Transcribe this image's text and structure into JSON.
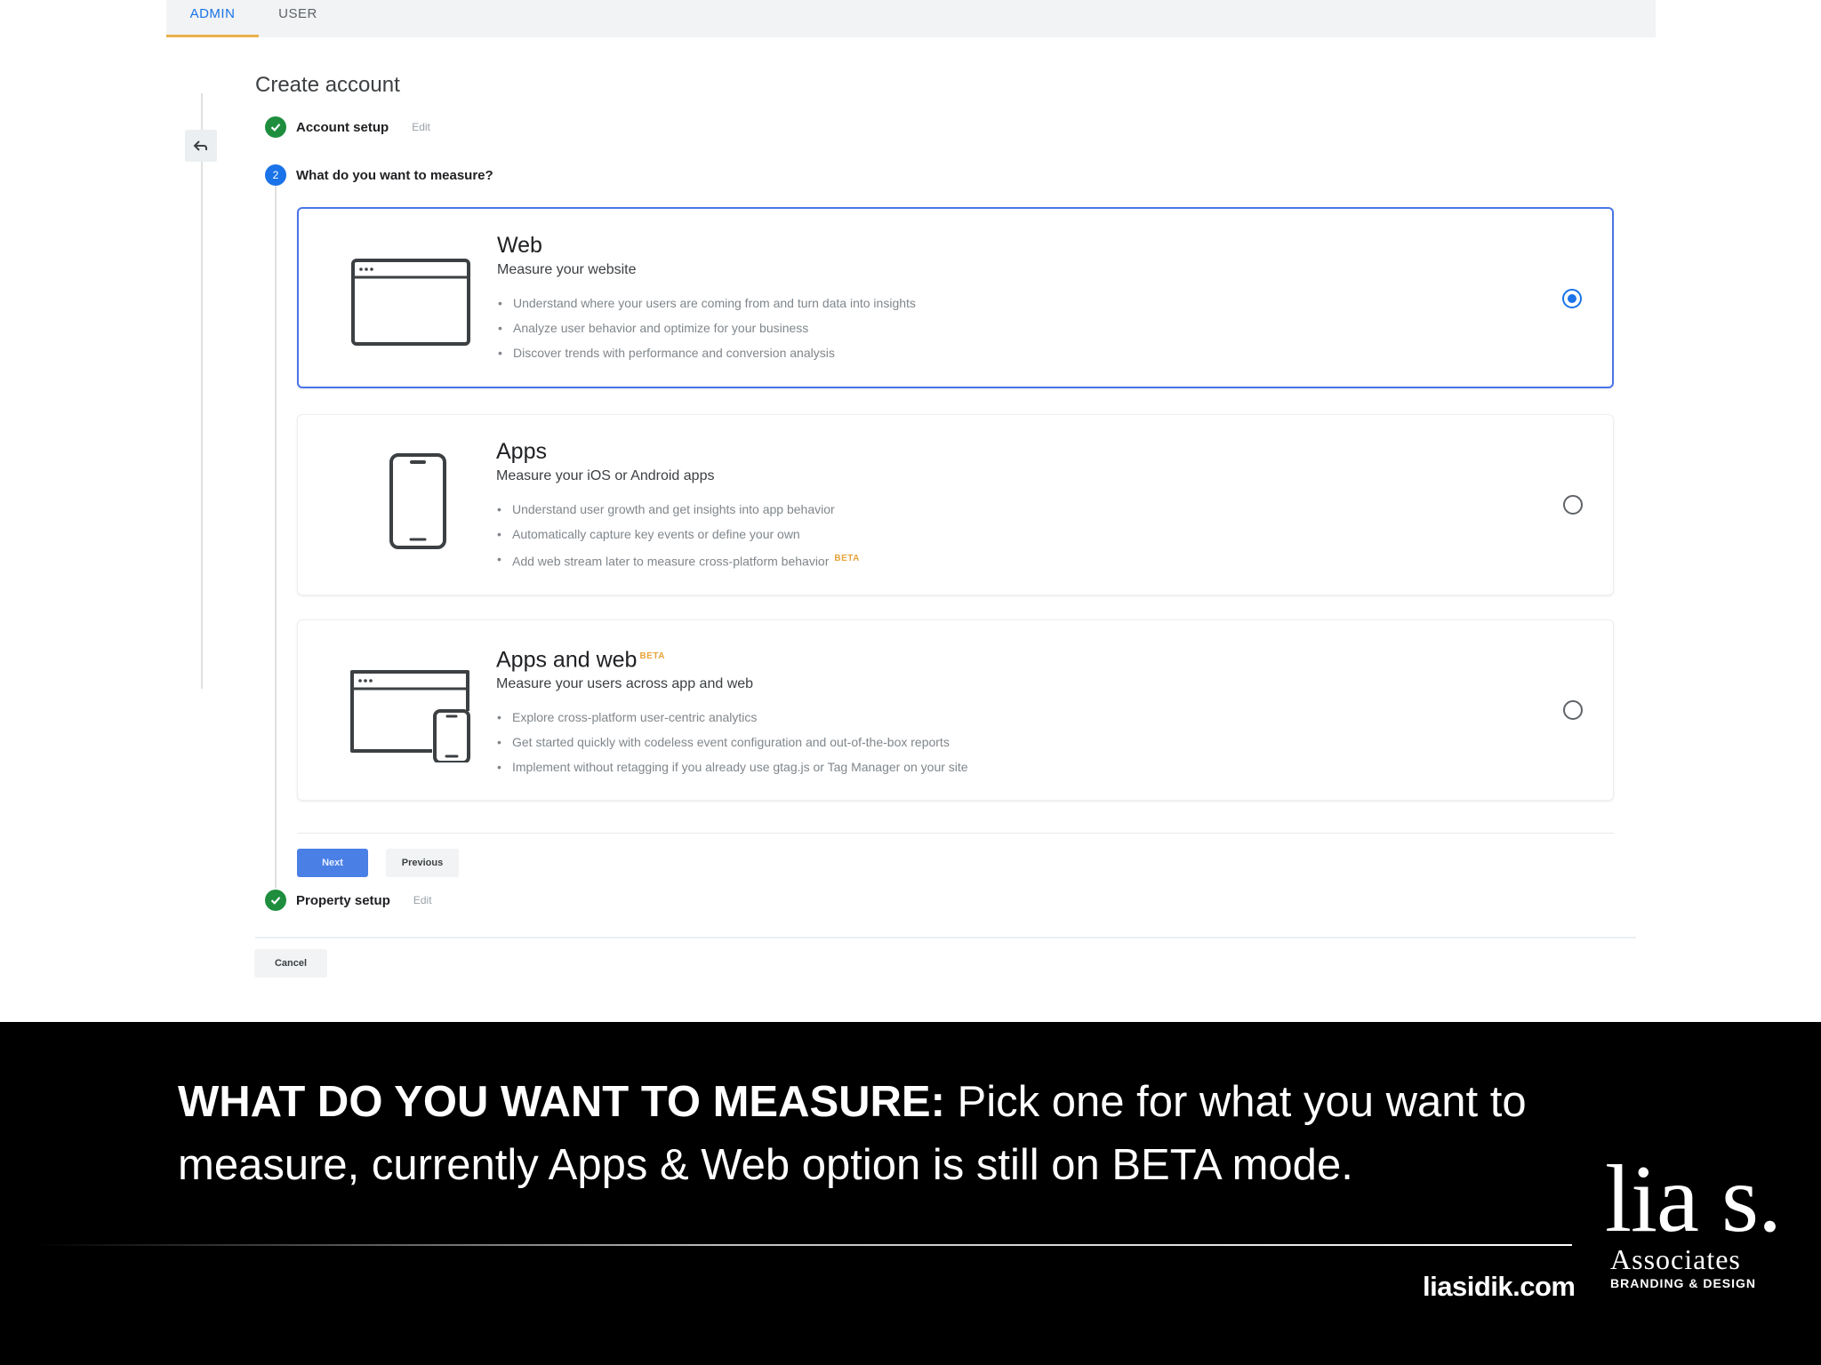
{
  "tabs": [
    {
      "label": "ADMIN",
      "active": true
    },
    {
      "label": "USER",
      "active": false
    }
  ],
  "page_title": "Create account",
  "steps": {
    "account": {
      "label": "Account setup",
      "edit": "Edit",
      "status": "done"
    },
    "measure": {
      "label": "What do you want to measure?",
      "number": "2",
      "status": "active"
    },
    "property": {
      "label": "Property setup",
      "edit": "Edit",
      "status": "done"
    }
  },
  "options": [
    {
      "title": "Web",
      "subtitle": "Measure your website",
      "bullets": [
        "Understand where your users are coming from and turn data into insights",
        "Analyze user behavior and optimize for your business",
        "Discover trends with performance and conversion analysis"
      ],
      "selected": true
    },
    {
      "title": "Apps",
      "subtitle": "Measure your iOS or Android apps",
      "bullets": [
        "Understand user growth and get insights into app behavior",
        "Automatically capture key events or define your own",
        "Add web stream later to measure cross-platform behavior"
      ],
      "bullet_badge": "BETA",
      "selected": false
    },
    {
      "title": "Apps and web",
      "title_badge": "BETA",
      "subtitle": "Measure your users across app and web",
      "bullets": [
        "Explore cross-platform user-centric analytics",
        "Get started quickly with codeless event configuration and out-of-the-box reports",
        "Implement without retagging if you already use gtag.js or Tag Manager on your site"
      ],
      "selected": false
    }
  ],
  "buttons": {
    "next": "Next",
    "previous": "Previous",
    "cancel": "Cancel"
  },
  "caption": {
    "lead": "WHAT DO YOU WANT TO MEASURE:",
    "body": " Pick one for what you want to measure, currently Apps & Web option is still on BETA mode.",
    "site": "liasidik.com"
  },
  "logo": {
    "mark": "lia s.",
    "word": "Associates",
    "tag": "BRANDING & DESIGN"
  },
  "colors": {
    "accent": "#1a73e8",
    "done": "#1e8e3e",
    "beta": "#e8a33b",
    "caption_bg": "#000000"
  }
}
